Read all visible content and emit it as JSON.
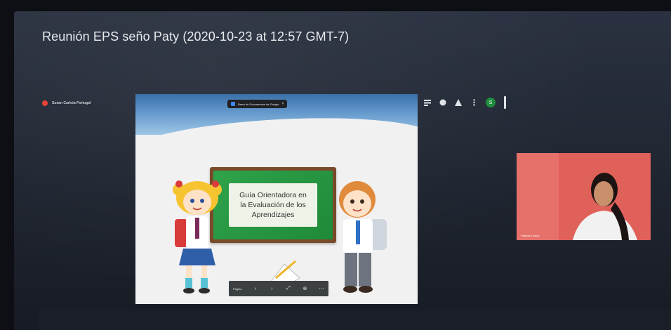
{
  "meeting": {
    "title": "Reunión EPS seño Paty (2020-10-23 at 12:57 GMT-7)"
  },
  "presenter": {
    "name": "Susan Carlota Portugal"
  },
  "document_chip": {
    "label": "Barra de Documentos de Google",
    "close_icon": "close-icon"
  },
  "slide": {
    "title_lines": [
      "Guía Orientadora en",
      "la Evaluación de los",
      "Aprendizajes"
    ]
  },
  "slide_controls": {
    "page_label": "Página"
  },
  "participant": {
    "name": "Patricia Lemus"
  },
  "toolbar": {
    "icons": [
      "chat-icon",
      "comment-icon",
      "people-icon",
      "more-icon"
    ],
    "avatar_initial": "S"
  },
  "colors": {
    "accent_green": "#1e8e3e",
    "record_red": "#ea4335",
    "board_green": "#2fa34a",
    "participant_bg": "#e0605a"
  }
}
